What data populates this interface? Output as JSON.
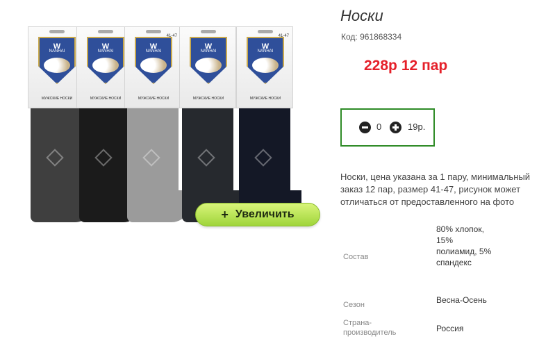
{
  "product": {
    "title": "Носки",
    "code": "Код: 961868334",
    "price": "228р",
    "pack": "12 пар",
    "description": "Носки, цена указана за 1 пару, минимальный заказ 12 пар, размер 41-47, рисунок может отличаться от предоставленного на фото"
  },
  "gallery": {
    "zoom_label": "Увеличить",
    "zoom_icon": "+",
    "package": {
      "brand_letter": "W",
      "brand_name": "NANHAI",
      "caption": "МУЖСКИЕ НОСКИ",
      "size": "41-47"
    },
    "sock_colors": [
      "#3f3f3f",
      "#1b1b1b",
      "#9b9b9b",
      "#26292e",
      "#141826"
    ]
  },
  "quantity": {
    "value": "0",
    "unit_price": "19р."
  },
  "specs": [
    {
      "label": "Состав",
      "value": "80% хлопок, 15% полиамид, 5% спандекс"
    },
    {
      "label": "Сезон",
      "value": "Весна-Осень"
    },
    {
      "label": "Страна-производитель",
      "value": "Россия"
    }
  ],
  "colors": {
    "price": "#e5202a",
    "qty_border": "#2e8b26",
    "zoom_button": "#b5e052"
  }
}
